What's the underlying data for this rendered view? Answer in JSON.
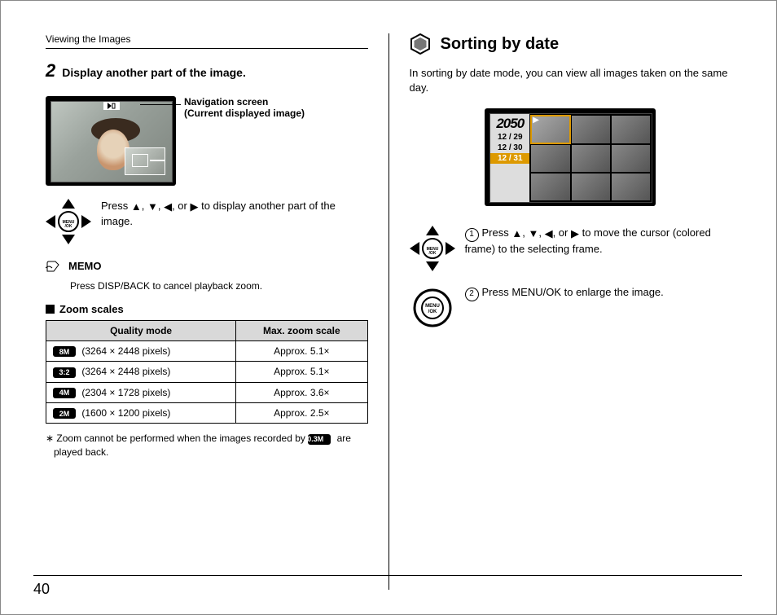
{
  "header": {
    "running": "Viewing the Images"
  },
  "left": {
    "step_num": "2",
    "step_title": "Display another part of the image.",
    "nav_caption_l1": "Navigation screen",
    "nav_caption_l2": "(Current displayed image)",
    "press_prefix": "Press ",
    "press_suffix": " to display another part of the image.",
    "arrow_sep": ", ",
    "arrow_or": ", or ",
    "memo_label": "MEMO",
    "memo_text": "Press DISP/BACK to cancel playback zoom.",
    "zoom_heading": "Zoom scales",
    "table": {
      "h1": "Quality mode",
      "h2": "Max. zoom scale",
      "rows": [
        {
          "badge": "8M",
          "res": "(3264 × 2448 pixels)",
          "zoom": "Approx. 5.1×"
        },
        {
          "badge": "3:2",
          "res": "(3264 × 2448 pixels)",
          "zoom": "Approx. 5.1×"
        },
        {
          "badge": "4M",
          "res": "(2304 × 1728 pixels)",
          "zoom": "Approx. 3.6×"
        },
        {
          "badge": "2M",
          "res": "(1600 × 1200 pixels)",
          "zoom": "Approx. 2.5×"
        }
      ]
    },
    "footnote_badge": "0.3M",
    "footnote_pre": "∗ Zoom cannot be performed when the images recorded by ",
    "footnote_post": " are played back."
  },
  "right": {
    "title": "Sorting by date",
    "intro": "In sorting by date mode, you can view all images taken on the same day.",
    "year": "2050",
    "dates": [
      "12 / 29",
      "12 / 30",
      "12 / 31"
    ],
    "step1_num": "1",
    "step1_pre": "Press ",
    "step1_post": " to move the cursor (colored frame) to the selecting frame.",
    "step2_num": "2",
    "step2_text": "Press MENU/OK to enlarge the image."
  },
  "page_number": "40"
}
